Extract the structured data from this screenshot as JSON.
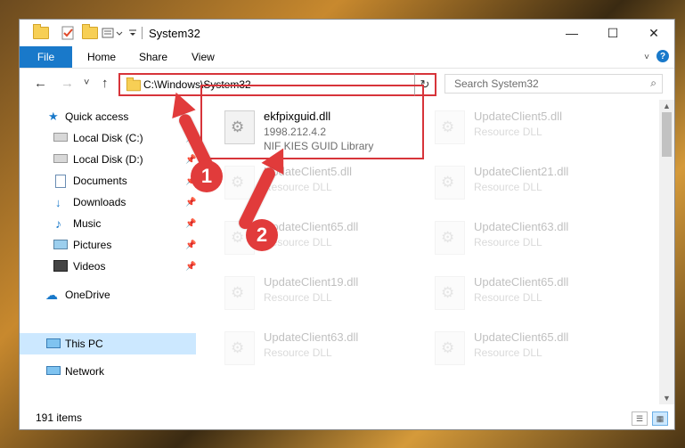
{
  "window": {
    "title": "System32",
    "controls": {
      "minimize": "—",
      "maximize": "☐",
      "close": "✕"
    }
  },
  "ribbon": {
    "file_tab": "File",
    "tabs": [
      "Home",
      "Share",
      "View"
    ],
    "help": "?"
  },
  "navigation": {
    "back": "←",
    "forward": "→",
    "recent": "˅",
    "up": "↑",
    "address": "C:\\Windows\\System32",
    "address_dropdown": "˅",
    "refresh": "↻",
    "search_placeholder": "Search System32",
    "search_icon": "⌕"
  },
  "sidebar": {
    "items": [
      {
        "label": "Quick access",
        "icon": "star-icon",
        "pinned": false
      },
      {
        "label": "Local Disk (C:)",
        "icon": "drive-icon",
        "pinned": true
      },
      {
        "label": "Local Disk (D:)",
        "icon": "drive-icon",
        "pinned": true
      },
      {
        "label": "Documents",
        "icon": "documents-icon",
        "pinned": true
      },
      {
        "label": "Downloads",
        "icon": "downloads-icon",
        "pinned": true
      },
      {
        "label": "Music",
        "icon": "music-icon",
        "pinned": true
      },
      {
        "label": "Pictures",
        "icon": "pictures-icon",
        "pinned": true
      },
      {
        "label": "Videos",
        "icon": "videos-icon",
        "pinned": true
      },
      {
        "label": "OneDrive",
        "icon": "cloud-icon",
        "pinned": false
      },
      {
        "label": "This PC",
        "icon": "computer-icon",
        "pinned": false,
        "selected": true
      },
      {
        "label": "Network",
        "icon": "network-icon",
        "pinned": false
      }
    ],
    "pin_glyph": "📌"
  },
  "files": [
    {
      "name": "ekfpixguid.dll",
      "line2": "1998.212.4.2",
      "line3": "NIF KIES GUID Library",
      "faded": false
    },
    {
      "name": "UpdateClient5.dll",
      "line2": "Resource DLL",
      "faded": true
    },
    {
      "name": "UpdateClient5.dll",
      "line2": "Resource DLL",
      "faded": true
    },
    {
      "name": "UpdateClient21.dll",
      "line2": "Resource DLL",
      "faded": true
    },
    {
      "name": "UpdateClient65.dll",
      "line2": "Resource DLL",
      "faded": true
    },
    {
      "name": "UpdateClient63.dll",
      "line2": "Resource DLL",
      "faded": true
    },
    {
      "name": "UpdateClient19.dll",
      "line2": "Resource DLL",
      "faded": true
    },
    {
      "name": "UpdateClient65.dll",
      "line2": "Resource DLL",
      "faded": true
    },
    {
      "name": "UpdateClient63.dll",
      "line2": "Resource DLL",
      "faded": true
    },
    {
      "name": "UpdateClient65.dll",
      "line2": "Resource DLL",
      "faded": true
    }
  ],
  "status": {
    "item_count": "191 items"
  },
  "annotations": {
    "step1": "1",
    "step2": "2"
  },
  "colors": {
    "accent": "#1979ca",
    "highlight_red": "#d7343a",
    "annotation_red": "#e13b3b",
    "selected_bg": "#cce8ff"
  }
}
